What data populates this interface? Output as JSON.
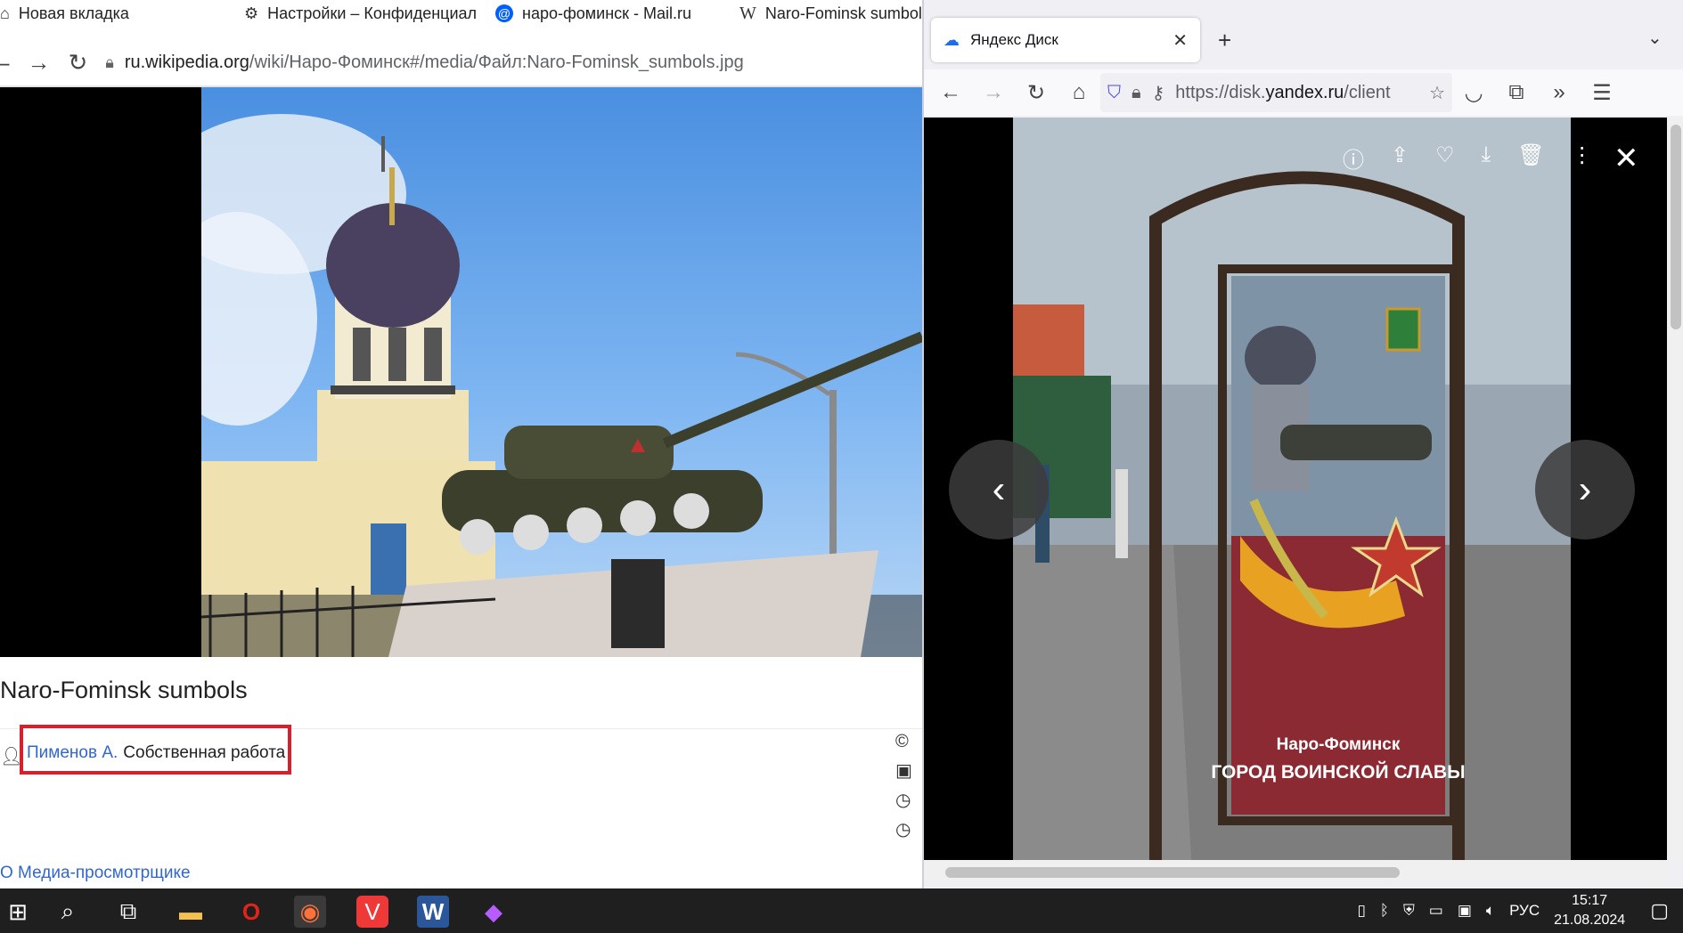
{
  "left_browser": {
    "tabs": [
      {
        "icon": "home-icon",
        "label": "Новая вкладка"
      },
      {
        "icon": "gear-icon",
        "label": "Настройки – Конфиденциал"
      },
      {
        "icon": "mailru-icon",
        "label": "наро-фоминск - Mail.ru"
      },
      {
        "icon": "wikipedia-icon",
        "label": "Naro-Fominsk sumbol"
      }
    ],
    "url": {
      "host": "ru.wikipedia.org",
      "path": "/wiki/Наро-Фоминск#/media/Файл:Naro-Fominsk_sumbols.jpg"
    },
    "file_title": "Naro-Fominsk sumbols",
    "author_link": "Пименов А.",
    "author_note": "Собственная работа",
    "about_link": "О Медиа-просмотрщике"
  },
  "right_browser": {
    "tab_label": "Яндекс Диск",
    "url": {
      "prefix": "https://disk.",
      "domain": "yandex.ru",
      "suffix": "/client"
    },
    "photo_caption": {
      "line1": "Наро-Фоминск",
      "line2": "ГОРОД ВОИНСКОЙ СЛАВЫ"
    }
  },
  "taskbar": {
    "language": "РУС",
    "time": "15:17",
    "date": "21.08.2024"
  }
}
